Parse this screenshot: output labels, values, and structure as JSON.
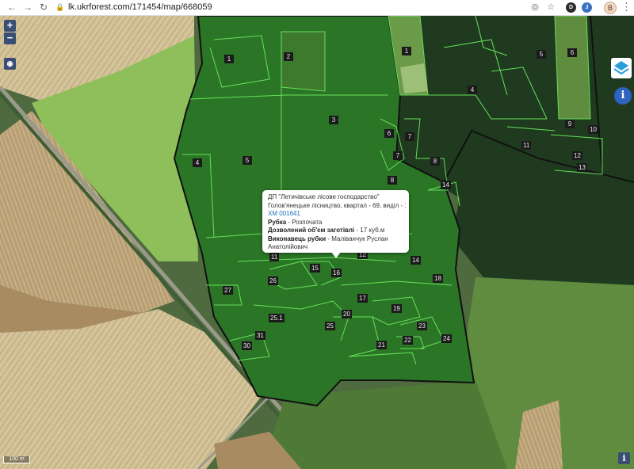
{
  "browser": {
    "url": "lk.ukrforest.com/171454/map/668059",
    "profile_initial": "B"
  },
  "map": {
    "zoom_in_label": "+",
    "zoom_out_label": "−",
    "scale_label": "100 m",
    "attribution_label": "i",
    "parcel_labels": [
      "1",
      "2",
      "3",
      "4",
      "5",
      "6",
      "7",
      "8",
      "9",
      "10",
      "11",
      "12",
      "13",
      "14",
      "15",
      "16",
      "17",
      "18",
      "19",
      "20",
      "21",
      "22",
      "23",
      "24",
      "25",
      "25.1",
      "26",
      "27",
      "30",
      "31"
    ]
  },
  "popup": {
    "line1": "ДП \"Летичівське лісове господарство\"",
    "line2": "Голов'янецьке лісництво, квартал - 69, виділ - 16",
    "code": "ХМ 001641",
    "felling_label": "Рубка",
    "felling_value": " - Розпочата",
    "volume_label": "Дозволений об'єм заготівлі",
    "volume_value": " - 17 куб.м",
    "executor_label": "Виконавець рубки",
    "executor_value": " - Маліванчук Руслан",
    "executor_value_2": "Анатолійович"
  },
  "colors": {
    "parcel_line": "#66e05a",
    "boundary": "#111111",
    "parcel_fill": "rgba(40,170,40,0.35)",
    "control_bg": "#3a4d73"
  }
}
